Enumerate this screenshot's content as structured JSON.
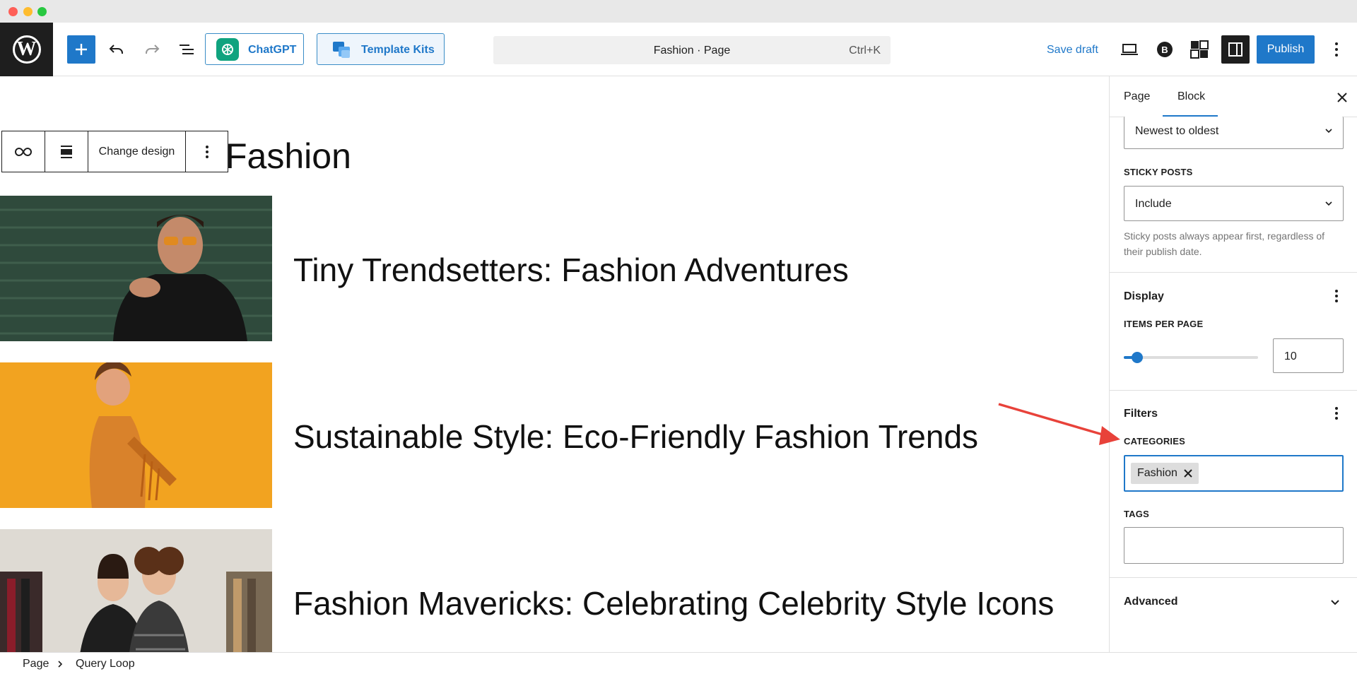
{
  "toolbar": {
    "chatgpt_label": "ChatGPT",
    "template_kits_label": "Template Kits",
    "document_title": "Fashion · Page",
    "shortcut": "Ctrl+K",
    "save_draft_label": "Save draft",
    "publish_label": "Publish"
  },
  "block_toolbar": {
    "change_design_label": "Change design"
  },
  "page": {
    "heading": "Fashion",
    "posts": [
      {
        "title": "Tiny Trendsetters: Fashion Adventures"
      },
      {
        "title": "Sustainable Style: Eco-Friendly Fashion Trends"
      },
      {
        "title": "Fashion Mavericks: Celebrating Celebrity Style Icons"
      }
    ]
  },
  "sidebar": {
    "tabs": [
      "Page",
      "Block"
    ],
    "active_tab": "Block",
    "order_value": "Newest to oldest",
    "sticky_posts_label": "STICKY POSTS",
    "sticky_posts_value": "Include",
    "sticky_help": "Sticky posts always appear first, regardless of their publish date.",
    "display_title": "Display",
    "items_per_page_label": "ITEMS PER PAGE",
    "items_per_page_value": "10",
    "items_per_page_slider_fraction": 0.1,
    "filters_title": "Filters",
    "categories_label": "CATEGORIES",
    "categories_tokens": [
      "Fashion"
    ],
    "tags_label": "TAGS",
    "advanced_title": "Advanced"
  },
  "breadcrumb": [
    "Page",
    "Query Loop"
  ],
  "colors": {
    "accent": "#1f78c9",
    "annotation_arrow": "#e8423a",
    "chatgpt_green": "#10a37f"
  }
}
